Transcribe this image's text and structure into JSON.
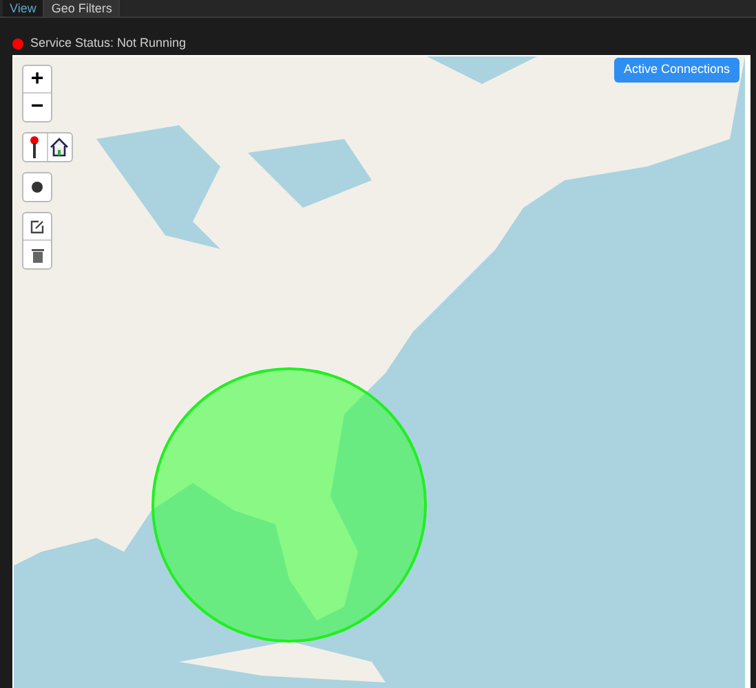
{
  "tabs": [
    {
      "label": "View",
      "selected": true
    },
    {
      "label": "Geo Filters",
      "selected": false
    }
  ],
  "status": {
    "text": "Service Status: Not Running",
    "color": "#ff0000"
  },
  "map": {
    "zoom_in": "+",
    "zoom_out": "−",
    "button": "Active Connections"
  }
}
